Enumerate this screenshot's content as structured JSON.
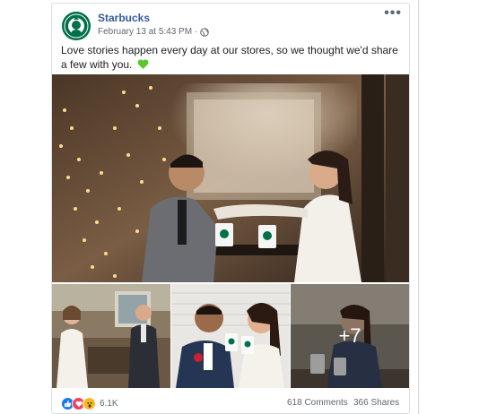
{
  "post": {
    "page_name": "Starbucks",
    "timestamp": "February 13 at 5:43 PM",
    "separator": "·",
    "privacy_icon": "globe-icon",
    "more_icon": "ellipsis-icon",
    "more_label": "•••",
    "text": "Love stories happen every day at our stores, so we thought we'd share a few with you.",
    "emoji": "green-heart-icon"
  },
  "photos": {
    "more_count_label": "+7"
  },
  "footer": {
    "reaction_icons": [
      "like-icon",
      "love-icon",
      "wow-icon"
    ],
    "reaction_count": "6.1K",
    "comments": "618 Comments",
    "shares": "366 Shares"
  },
  "colors": {
    "brand_green": "#00704a",
    "link_blue": "#365899",
    "heart_green": "#5ac72e"
  }
}
